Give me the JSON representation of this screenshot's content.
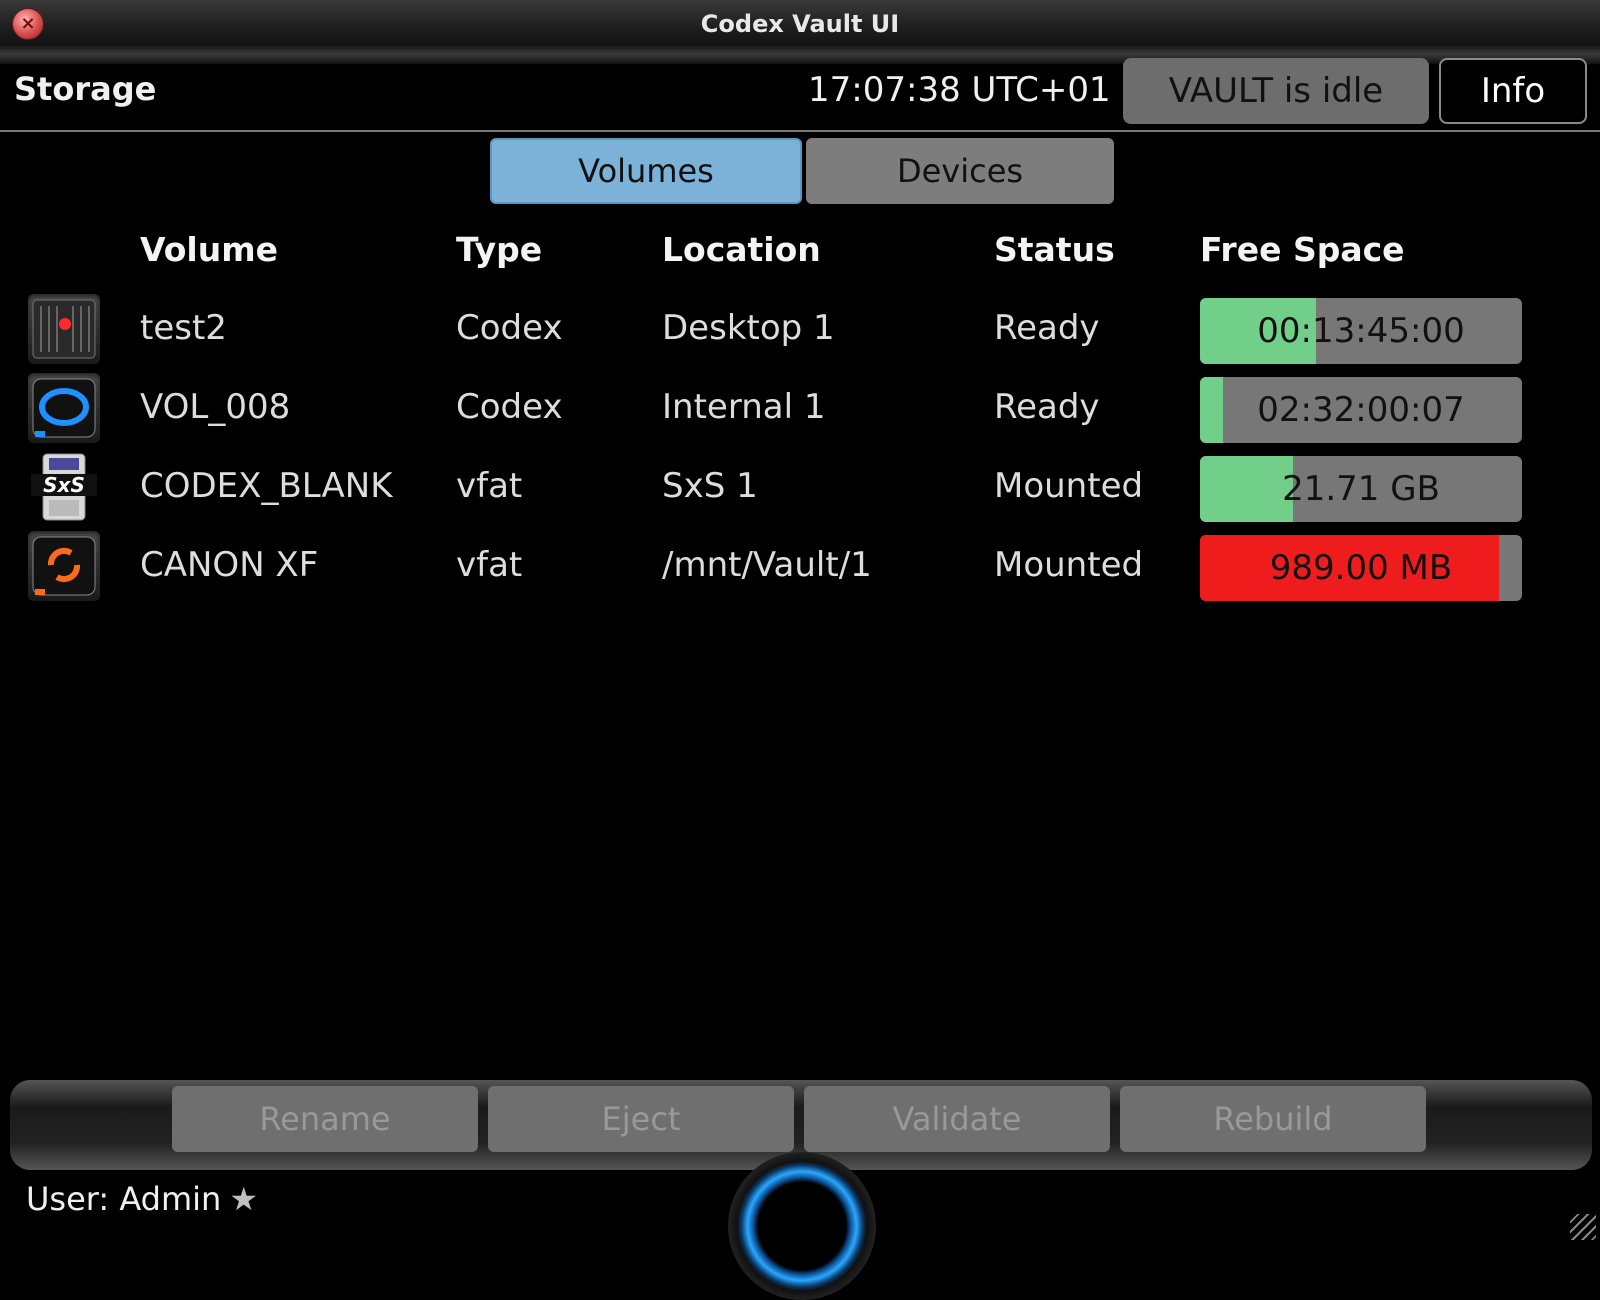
{
  "window": {
    "title": "Codex Vault UI"
  },
  "header": {
    "title": "Storage",
    "clock": "17:07:38 UTC+01",
    "status_button": "VAULT is idle",
    "info_button": "Info"
  },
  "tabs": [
    {
      "label": "Volumes",
      "active": true
    },
    {
      "label": "Devices",
      "active": false
    }
  ],
  "columns": {
    "volume": "Volume",
    "type": "Type",
    "location": "Location",
    "status": "Status",
    "free_space": "Free Space"
  },
  "volumes": [
    {
      "icon": "hard-drive-icon",
      "volume": "test2",
      "type": "Codex",
      "location": "Desktop 1",
      "status": "Ready",
      "free_space": "00:13:45:00",
      "free_fraction": 0.36,
      "bar_color": "#72cf8a"
    },
    {
      "icon": "codex-capture-drive-icon",
      "volume": "VOL_008",
      "type": "Codex",
      "location": "Internal 1",
      "status": "Ready",
      "free_space": "02:32:00:07",
      "free_fraction": 0.07,
      "bar_color": "#72cf8a"
    },
    {
      "icon": "sxs-card-icon",
      "volume": "CODEX_BLANK",
      "type": "vfat",
      "location": "SxS 1",
      "status": "Mounted",
      "free_space": "21.71 GB",
      "free_fraction": 0.29,
      "bar_color": "#72cf8a"
    },
    {
      "icon": "canon-xf-drive-icon",
      "volume": "CANON XF",
      "type": "vfat",
      "location": "/mnt/Vault/1",
      "status": "Mounted",
      "free_space": "989.00 MB",
      "free_fraction": 0.93,
      "bar_color": "#ee1c1c"
    }
  ],
  "actions": {
    "rename": "Rename",
    "eject": "Eject",
    "validate": "Validate",
    "rebuild": "Rebuild"
  },
  "footer": {
    "user": "User: Admin"
  }
}
